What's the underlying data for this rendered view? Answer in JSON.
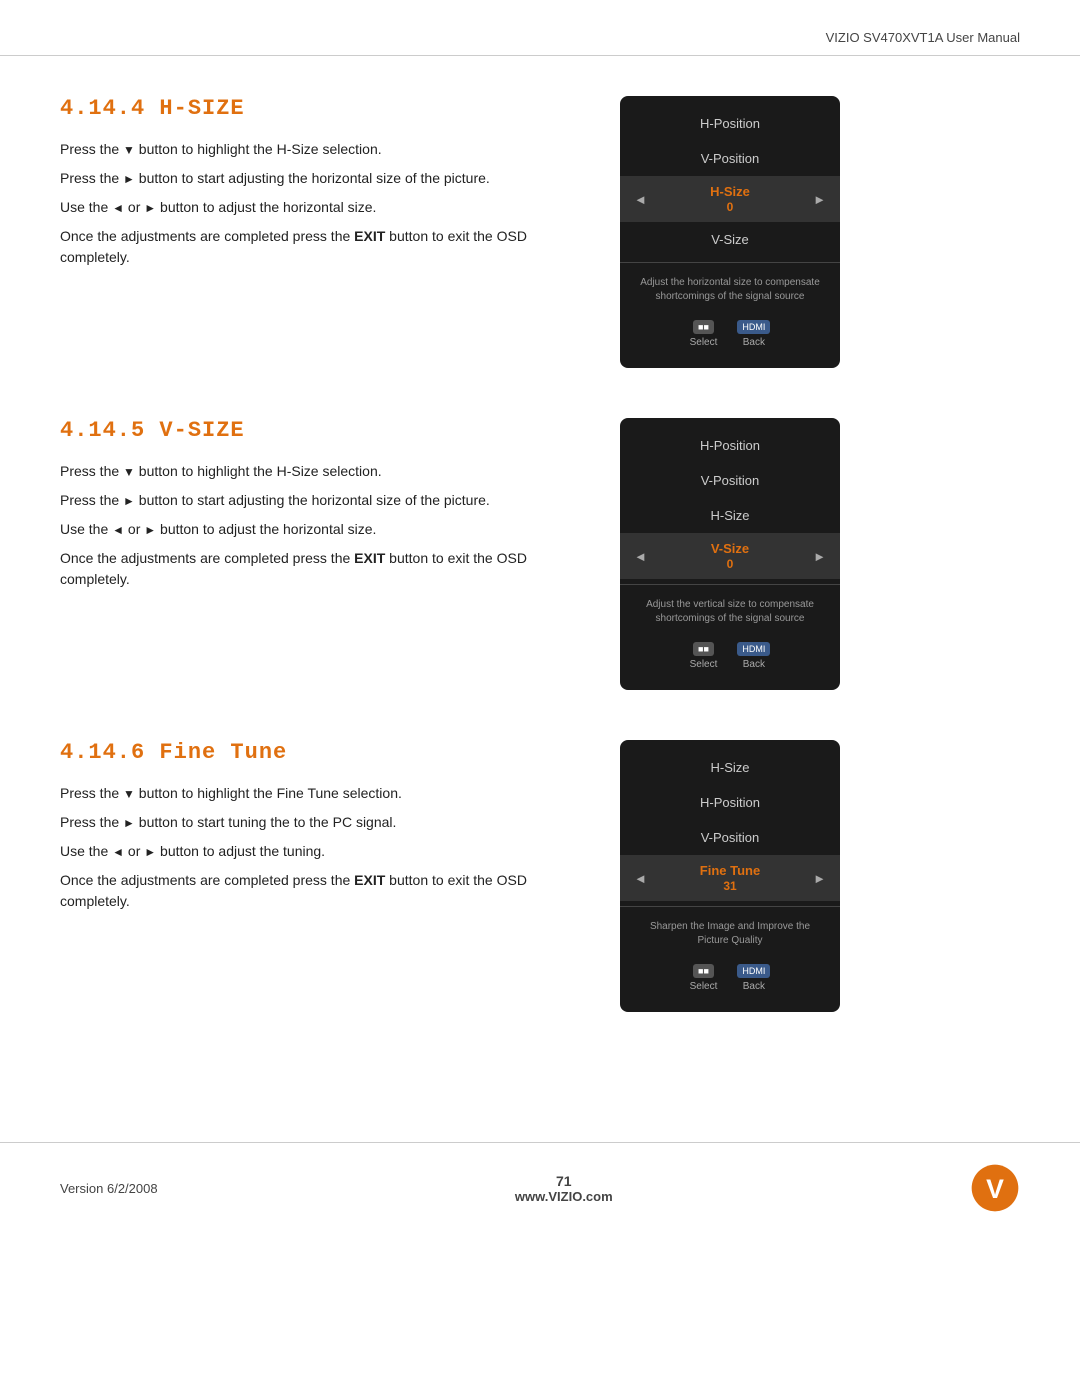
{
  "header": {
    "title": "VIZIO SV470XVT1A User Manual"
  },
  "sections": [
    {
      "id": "hsize",
      "heading": "4.14.4 H-SIZE",
      "paragraphs": [
        "Press the ▼ button to highlight the H-Size selection.",
        "Press the ► button to start adjusting the horizontal size of the picture.",
        "Use the ◄ or ► button to adjust the horizontal size.",
        "Once the adjustments are completed press the EXIT button to exit the OSD completely."
      ],
      "osd": {
        "items": [
          "H-Position",
          "V-Position"
        ],
        "active_item": "H-Size",
        "active_value": "0",
        "below_items": [
          "V-Size"
        ],
        "description": "Adjust the horizontal size to compensate shortcomings of the signal source",
        "select_label": "Select",
        "back_label": "Back"
      }
    },
    {
      "id": "vsize",
      "heading": "4.14.5 V-SIZE",
      "paragraphs": [
        "Press the ▼ button to highlight the H-Size selection.",
        "Press the ► button to start adjusting the horizontal size of the picture.",
        "Use the ◄ or ► button to adjust the horizontal size.",
        "Once the adjustments are completed press the EXIT button to exit the OSD completely."
      ],
      "osd": {
        "items": [
          "H-Position",
          "V-Position",
          "H-Size"
        ],
        "active_item": "V-Size",
        "active_value": "0",
        "below_items": [],
        "description": "Adjust the vertical size to compensate shortcomings of the signal source",
        "select_label": "Select",
        "back_label": "Back"
      }
    },
    {
      "id": "finetune",
      "heading": "4.14.6 Fine Tune",
      "paragraphs": [
        "Press the ▼ button to highlight the Fine Tune selection.",
        "Press the ► button to start tuning the to the PC signal.",
        "Use the ◄ or ► button to adjust the tuning.",
        "Once the adjustments are completed press the EXIT button to exit the OSD completely."
      ],
      "osd": {
        "items": [
          "H-Size",
          "H-Position",
          "V-Position"
        ],
        "active_item": "Fine Tune",
        "active_value": "31",
        "below_items": [],
        "description": "Sharpen the Image and Improve the Picture Quality",
        "select_label": "Select",
        "back_label": "Back"
      }
    }
  ],
  "footer": {
    "version": "Version 6/2/2008",
    "page_number": "71",
    "website": "www.VIZIO.com"
  }
}
